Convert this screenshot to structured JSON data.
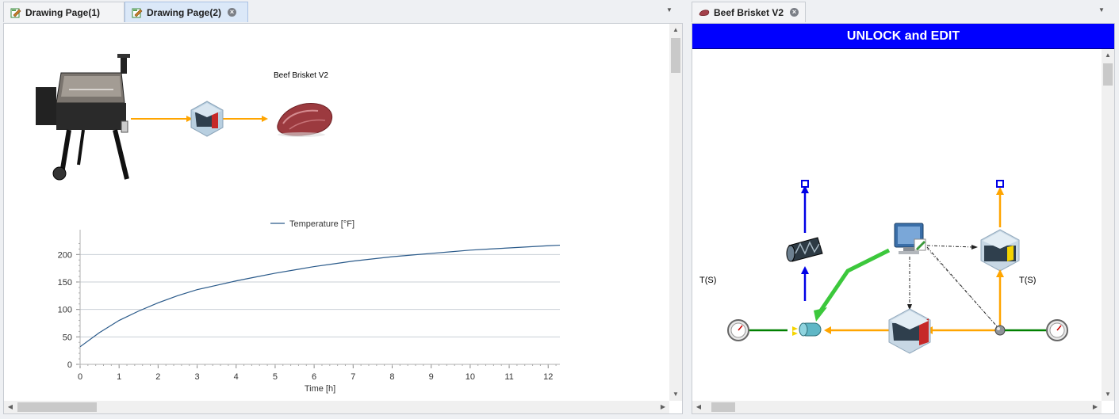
{
  "left_tabs": [
    {
      "label": "Drawing Page(1)",
      "active": false
    },
    {
      "label": "Drawing Page(2)",
      "active": true
    }
  ],
  "right_tabs": [
    {
      "label": "Beef Brisket V2",
      "active": true
    }
  ],
  "left_pane": {
    "object_label": "Beef Brisket V2"
  },
  "right_pane": {
    "banner": "UNLOCK and EDIT",
    "sensor_left_label": "T(S)",
    "sensor_right_label": "T(S)"
  },
  "chart_data": {
    "type": "line",
    "title": "",
    "xlabel": "Time [h]",
    "ylabel": "",
    "xlim": [
      0,
      12.3
    ],
    "ylim": [
      0,
      225
    ],
    "x_ticks": [
      0,
      1,
      2,
      3,
      4,
      5,
      6,
      7,
      8,
      9,
      10,
      11,
      12
    ],
    "y_ticks": [
      0,
      50,
      100,
      150,
      200
    ],
    "grid": true,
    "legend_position": "top-center",
    "series": [
      {
        "name": "Temperature [°F]",
        "color": "#2a5a8a",
        "x": [
          0,
          0.5,
          1,
          1.5,
          2,
          2.5,
          3,
          3.5,
          4,
          4.5,
          5,
          5.5,
          6,
          6.5,
          7,
          7.5,
          8,
          8.5,
          9,
          9.5,
          10,
          10.5,
          11,
          11.5,
          12,
          12.3
        ],
        "y": [
          32,
          58,
          80,
          97,
          112,
          125,
          136,
          144,
          152,
          159,
          166,
          172,
          178,
          183,
          188,
          192,
          196,
          199,
          202,
          205,
          208,
          210,
          212,
          214,
          216,
          217
        ]
      }
    ]
  },
  "colors": {
    "banner": "#0000ff",
    "stream_orange": "#ffa500",
    "stream_blue": "#0000e6",
    "energy_green": "#3cc83c",
    "sensor_green": "#008000",
    "active_tab": "#dbe8f8"
  }
}
